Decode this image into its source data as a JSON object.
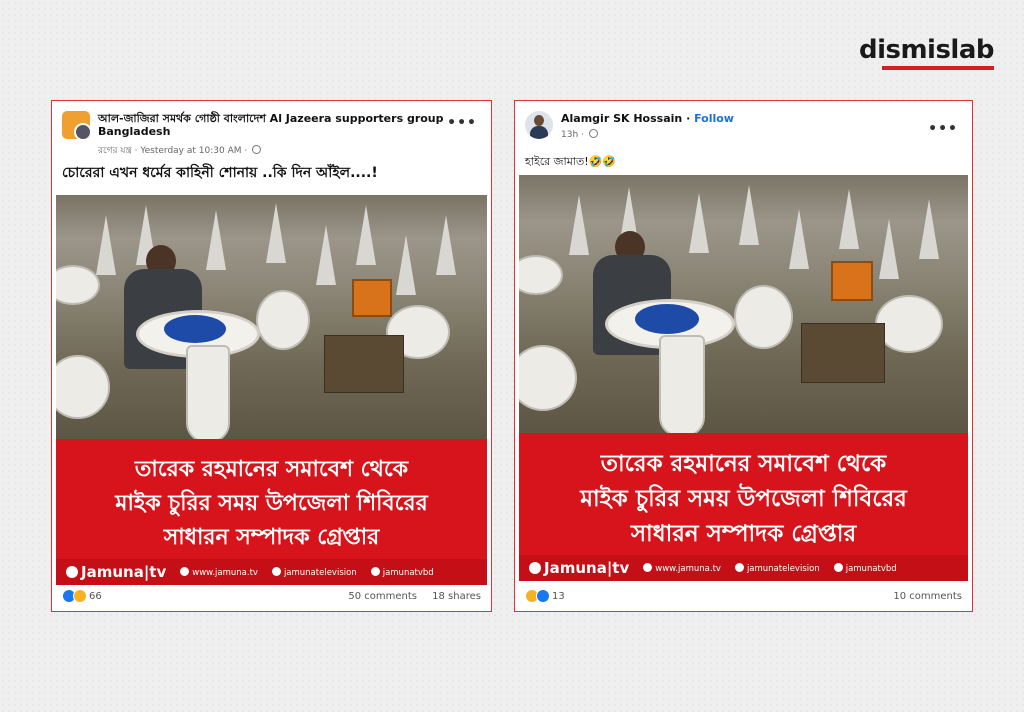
{
  "brand": {
    "name": "dismislab",
    "accent": "#d32020"
  },
  "posts": [
    {
      "author": "আল-জাজিরা সমর্থক গোষ্ঠী বাংলাদেশ Al Jazeera supporters group Bangladesh",
      "sub_author": "রগের যন্ত্র",
      "time": "Yesterday at 10:30 AM",
      "caption": "চোরেরা এখন ধর্মের কাহিনী শোনায় ..কি দিন আঁইল....!",
      "banner_lines": [
        "তারেক রহমানের সমাবেশ থেকে",
        "মাইক চুরির সময় উপজেলা শিবিরের",
        "সাধারন সম্পাদক গ্রেপ্তার"
      ],
      "footer": {
        "logo": "Jamuna|tv",
        "web": "www.jamuna.tv",
        "facebook": "jamunatelevision",
        "youtube": "jamunatvbd"
      },
      "reactions_count": "66",
      "comments": "50 comments",
      "shares": "18 shares",
      "menu_icon": "more-dots-icon"
    },
    {
      "author": "Alamgir SK Hossain",
      "follow": "Follow",
      "time": "13h",
      "caption": "হাইরে জামাত!🤣🤣",
      "banner_lines": [
        "তারেক রহমানের সমাবেশ থেকে",
        "মাইক চুরির সময় উপজেলা শিবিরের",
        "সাধারন সম্পাদক গ্রেপ্তার"
      ],
      "footer": {
        "logo": "Jamuna|tv",
        "web": "www.jamuna.tv",
        "facebook": "jamunatelevision",
        "youtube": "jamunatvbd"
      },
      "reactions_count": "13",
      "comments": "10 comments",
      "menu_icon": "more-dots-icon"
    }
  ],
  "colors": {
    "banner_red": "#d7141c",
    "footer_red": "#c40f17",
    "follow_blue": "#1b6fd8",
    "frame_red": "#dd3333"
  }
}
